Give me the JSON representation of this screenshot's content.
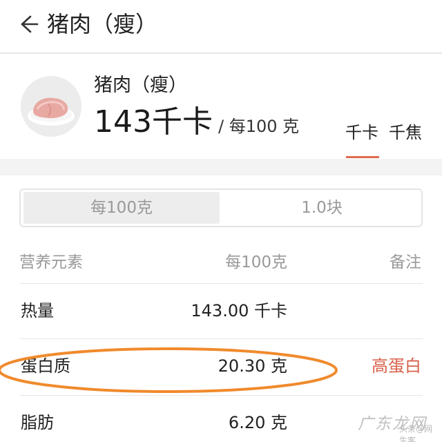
{
  "header": {
    "title": "猪肉（瘦）"
  },
  "food": {
    "image_icon": "meat-image",
    "name": "猪肉（瘦）",
    "calories": "143千卡",
    "per_unit": "/ 每100 克"
  },
  "unit_tabs": {
    "kcal": "千卡",
    "kj": "千焦",
    "accent_color": "#e06a4e"
  },
  "portion": {
    "per100g": "每100克",
    "piece": "1.0块"
  },
  "table": {
    "headers": {
      "nutrient": "营养元素",
      "per100g": "每100克",
      "note": "备注"
    },
    "rows": [
      {
        "name": "热量",
        "value": "143.00 千卡",
        "note": ""
      },
      {
        "name": "蛋白质",
        "value": "20.30 克",
        "note": "高蛋白"
      },
      {
        "name": "脂肪",
        "value": "6.20 克",
        "note": ""
      }
    ]
  },
  "annotation": {
    "color": "#f08a2c"
  },
  "watermark": {
    "text": "广东龙网",
    "sub": "头条@网生客"
  }
}
